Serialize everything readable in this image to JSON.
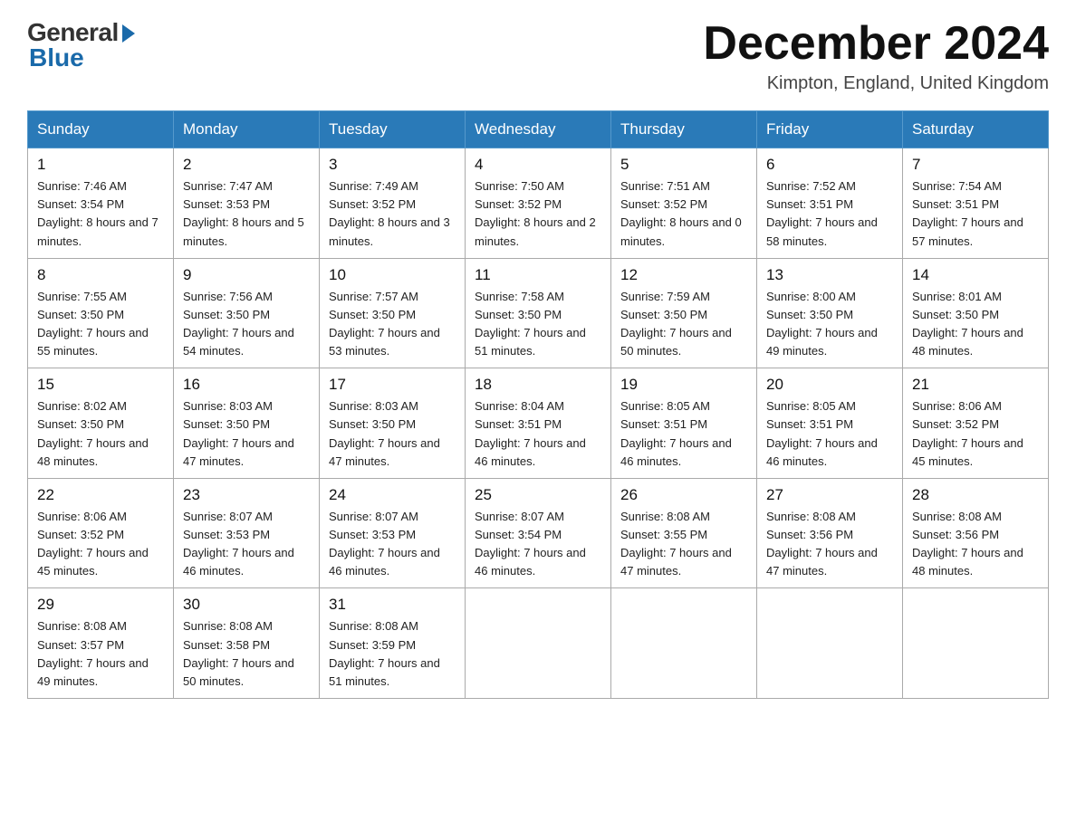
{
  "header": {
    "logo_general": "General",
    "logo_blue": "Blue",
    "month_title": "December 2024",
    "location": "Kimpton, England, United Kingdom"
  },
  "days_of_week": [
    "Sunday",
    "Monday",
    "Tuesday",
    "Wednesday",
    "Thursday",
    "Friday",
    "Saturday"
  ],
  "weeks": [
    [
      {
        "day": "1",
        "sunrise": "7:46 AM",
        "sunset": "3:54 PM",
        "daylight": "8 hours and 7 minutes."
      },
      {
        "day": "2",
        "sunrise": "7:47 AM",
        "sunset": "3:53 PM",
        "daylight": "8 hours and 5 minutes."
      },
      {
        "day": "3",
        "sunrise": "7:49 AM",
        "sunset": "3:52 PM",
        "daylight": "8 hours and 3 minutes."
      },
      {
        "day": "4",
        "sunrise": "7:50 AM",
        "sunset": "3:52 PM",
        "daylight": "8 hours and 2 minutes."
      },
      {
        "day": "5",
        "sunrise": "7:51 AM",
        "sunset": "3:52 PM",
        "daylight": "8 hours and 0 minutes."
      },
      {
        "day": "6",
        "sunrise": "7:52 AM",
        "sunset": "3:51 PM",
        "daylight": "7 hours and 58 minutes."
      },
      {
        "day": "7",
        "sunrise": "7:54 AM",
        "sunset": "3:51 PM",
        "daylight": "7 hours and 57 minutes."
      }
    ],
    [
      {
        "day": "8",
        "sunrise": "7:55 AM",
        "sunset": "3:50 PM",
        "daylight": "7 hours and 55 minutes."
      },
      {
        "day": "9",
        "sunrise": "7:56 AM",
        "sunset": "3:50 PM",
        "daylight": "7 hours and 54 minutes."
      },
      {
        "day": "10",
        "sunrise": "7:57 AM",
        "sunset": "3:50 PM",
        "daylight": "7 hours and 53 minutes."
      },
      {
        "day": "11",
        "sunrise": "7:58 AM",
        "sunset": "3:50 PM",
        "daylight": "7 hours and 51 minutes."
      },
      {
        "day": "12",
        "sunrise": "7:59 AM",
        "sunset": "3:50 PM",
        "daylight": "7 hours and 50 minutes."
      },
      {
        "day": "13",
        "sunrise": "8:00 AM",
        "sunset": "3:50 PM",
        "daylight": "7 hours and 49 minutes."
      },
      {
        "day": "14",
        "sunrise": "8:01 AM",
        "sunset": "3:50 PM",
        "daylight": "7 hours and 48 minutes."
      }
    ],
    [
      {
        "day": "15",
        "sunrise": "8:02 AM",
        "sunset": "3:50 PM",
        "daylight": "7 hours and 48 minutes."
      },
      {
        "day": "16",
        "sunrise": "8:03 AM",
        "sunset": "3:50 PM",
        "daylight": "7 hours and 47 minutes."
      },
      {
        "day": "17",
        "sunrise": "8:03 AM",
        "sunset": "3:50 PM",
        "daylight": "7 hours and 47 minutes."
      },
      {
        "day": "18",
        "sunrise": "8:04 AM",
        "sunset": "3:51 PM",
        "daylight": "7 hours and 46 minutes."
      },
      {
        "day": "19",
        "sunrise": "8:05 AM",
        "sunset": "3:51 PM",
        "daylight": "7 hours and 46 minutes."
      },
      {
        "day": "20",
        "sunrise": "8:05 AM",
        "sunset": "3:51 PM",
        "daylight": "7 hours and 46 minutes."
      },
      {
        "day": "21",
        "sunrise": "8:06 AM",
        "sunset": "3:52 PM",
        "daylight": "7 hours and 45 minutes."
      }
    ],
    [
      {
        "day": "22",
        "sunrise": "8:06 AM",
        "sunset": "3:52 PM",
        "daylight": "7 hours and 45 minutes."
      },
      {
        "day": "23",
        "sunrise": "8:07 AM",
        "sunset": "3:53 PM",
        "daylight": "7 hours and 46 minutes."
      },
      {
        "day": "24",
        "sunrise": "8:07 AM",
        "sunset": "3:53 PM",
        "daylight": "7 hours and 46 minutes."
      },
      {
        "day": "25",
        "sunrise": "8:07 AM",
        "sunset": "3:54 PM",
        "daylight": "7 hours and 46 minutes."
      },
      {
        "day": "26",
        "sunrise": "8:08 AM",
        "sunset": "3:55 PM",
        "daylight": "7 hours and 47 minutes."
      },
      {
        "day": "27",
        "sunrise": "8:08 AM",
        "sunset": "3:56 PM",
        "daylight": "7 hours and 47 minutes."
      },
      {
        "day": "28",
        "sunrise": "8:08 AM",
        "sunset": "3:56 PM",
        "daylight": "7 hours and 48 minutes."
      }
    ],
    [
      {
        "day": "29",
        "sunrise": "8:08 AM",
        "sunset": "3:57 PM",
        "daylight": "7 hours and 49 minutes."
      },
      {
        "day": "30",
        "sunrise": "8:08 AM",
        "sunset": "3:58 PM",
        "daylight": "7 hours and 50 minutes."
      },
      {
        "day": "31",
        "sunrise": "8:08 AM",
        "sunset": "3:59 PM",
        "daylight": "7 hours and 51 minutes."
      },
      null,
      null,
      null,
      null
    ]
  ]
}
